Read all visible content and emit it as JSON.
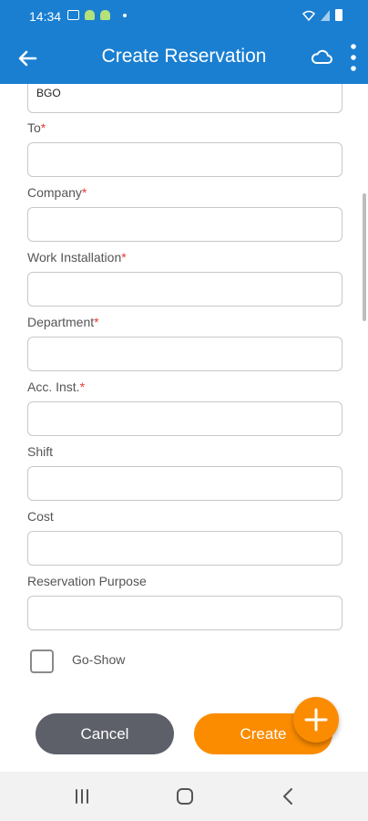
{
  "status_bar": {
    "time": "14:34"
  },
  "app_bar": {
    "title": "Create Reservation"
  },
  "form": {
    "from_value": "BGO",
    "fields": [
      {
        "label": "To",
        "required_mark": "*",
        "value": ""
      },
      {
        "label": "Company",
        "required_mark": "*",
        "value": ""
      },
      {
        "label": "Work Installation",
        "required_mark": "*",
        "value": ""
      },
      {
        "label": "Department",
        "required_mark": "*",
        "value": ""
      },
      {
        "label": "Acc. Inst.",
        "required_mark": "*",
        "value": ""
      },
      {
        "label": "Shift",
        "required_mark": "",
        "value": ""
      },
      {
        "label": "Cost",
        "required_mark": "",
        "value": ""
      },
      {
        "label": "Reservation Purpose",
        "required_mark": "",
        "value": ""
      }
    ],
    "go_show": {
      "label": "Go-Show",
      "checked": false
    }
  },
  "actions": {
    "cancel_label": "Cancel",
    "create_label": "Create"
  },
  "icons": {
    "back": "arrow-left-icon",
    "cloud": "cloud-icon",
    "more": "more-vertical-icon",
    "fab": "plus-icon",
    "nav_recent": "recent-apps-icon",
    "nav_home": "home-icon",
    "nav_back": "nav-back-icon"
  },
  "colors": {
    "primary": "#1a7fd1",
    "accent": "#fb8c00",
    "cancel": "#5d6069",
    "required": "#e53935"
  }
}
